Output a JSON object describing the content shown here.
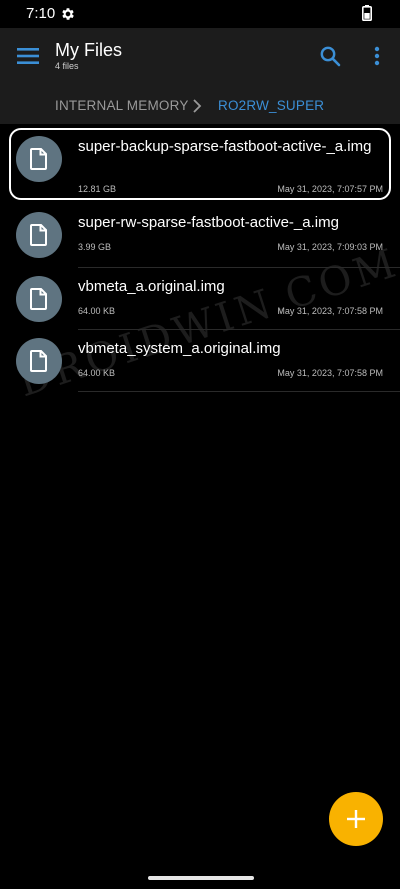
{
  "status_bar": {
    "time": "7:10"
  },
  "app_bar": {
    "title": "My Files",
    "subtitle": "4 files"
  },
  "breadcrumb": {
    "root": "INTERNAL MEMORY",
    "current": "RO2RW_SUPER"
  },
  "files": [
    {
      "name": "super-backup-sparse-fastboot-active-_a.img",
      "size": "12.81 GB",
      "date": "May 31, 2023, 7:07:57 PM",
      "highlighted": true
    },
    {
      "name": "super-rw-sparse-fastboot-active-_a.img",
      "size": "3.99 GB",
      "date": "May 31, 2023, 7:09:03 PM"
    },
    {
      "name": "vbmeta_a.original.img",
      "size": "64.00 KB",
      "date": "May 31, 2023, 7:07:58 PM"
    },
    {
      "name": "vbmeta_system_a.original.img",
      "size": "64.00 KB",
      "date": "May 31, 2023, 7:07:58 PM"
    }
  ],
  "watermark": "DROIDWIN.COM",
  "icons": {
    "menu": "hamburger-menu-icon",
    "search": "search-icon",
    "more": "more-vert-icon",
    "file": "file-icon",
    "add": "plus-icon",
    "chevron": "chevron-right-icon",
    "settings": "gear-icon",
    "battery": "battery-icon"
  },
  "colors": {
    "accent": "#3b8fd6",
    "fab": "#f9b200",
    "file_icon_bg": "#5f7481",
    "appbar_bg": "#1c1c1c"
  }
}
